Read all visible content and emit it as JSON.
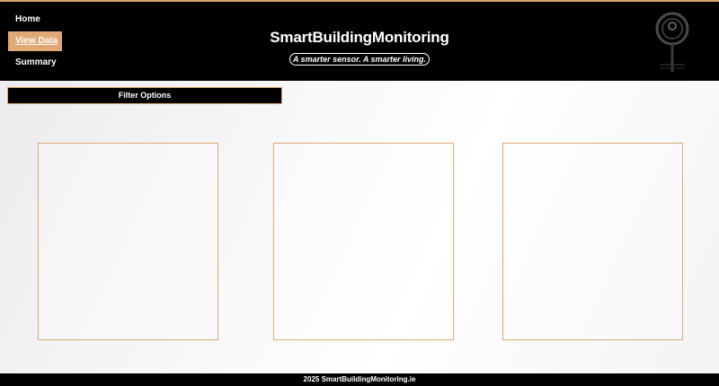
{
  "nav": {
    "home": "Home",
    "view_data": "View Data",
    "summary": "Summary"
  },
  "header": {
    "brand": "SmartBuildingMonitoring",
    "tagline": "A smarter sensor. A smarter living."
  },
  "main": {
    "filter_label": "Filter Options"
  },
  "footer": {
    "text": "2025 SmartBuildingMonitoring.ie"
  },
  "colors": {
    "accent": "#e0a874",
    "header_bg": "#000000"
  },
  "icons": {
    "logo": "sensor-logo-icon"
  }
}
